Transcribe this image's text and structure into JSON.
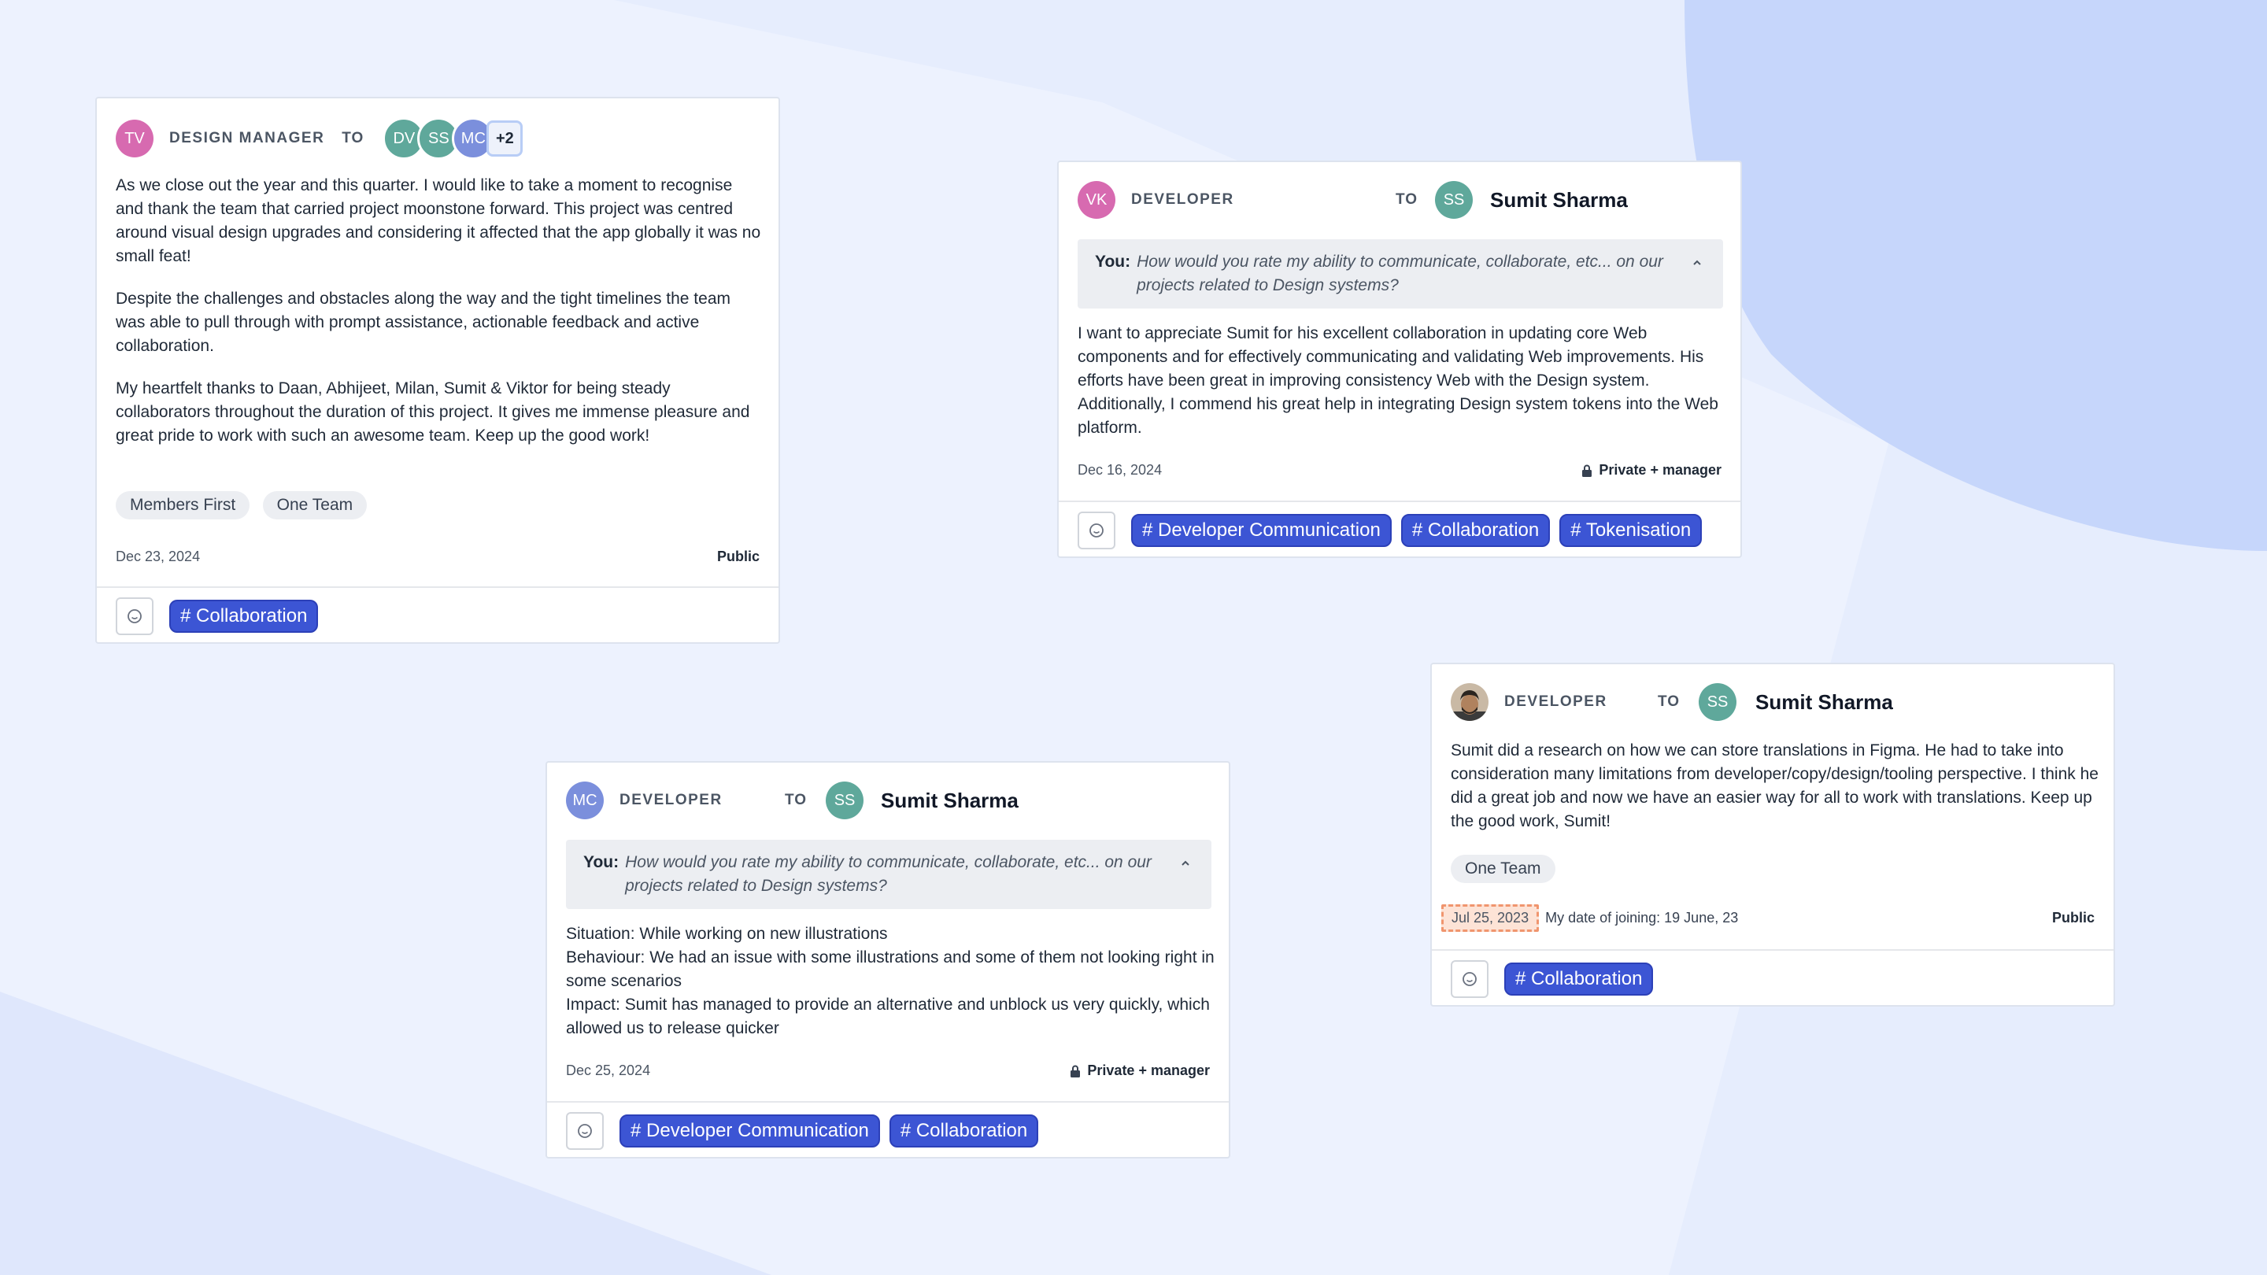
{
  "colors": {
    "background": "#e6edfd",
    "tag_blue": "#3c55d4",
    "avatar_pink": "#d76ab0",
    "avatar_teal": "#5fa89b",
    "avatar_periwinkle": "#7b8fdc"
  },
  "card1": {
    "author_initials": "TV",
    "author_role": "DESIGN MANAGER",
    "to_label": "TO",
    "recipients": [
      "DV",
      "SS",
      "MC"
    ],
    "more_count": "+2",
    "paragraphs": [
      "As we close out the year and this quarter. I would like to take a moment to recognise and thank the team that carried project moonstone forward. This project was centred around visual design upgrades and considering it affected that the app globally it was no small feat!",
      "Despite the challenges and obstacles along the way and the tight timelines the team was able to pull through with prompt assistance, actionable feedback and active collaboration.",
      "My heartfelt thanks to Daan, Abhijeet, Milan, Sumit & Viktor for being steady collaborators throughout the duration of this project. It gives me immense pleasure and great pride to work with such an awesome team. Keep up the good work!"
    ],
    "values": [
      "Members First",
      "One Team"
    ],
    "date": "Dec 23, 2024",
    "visibility": "Public",
    "tags": [
      "# Collaboration"
    ]
  },
  "card2": {
    "author_initials": "VK",
    "author_role": "DEVELOPER",
    "to_label": "TO",
    "recipient_initials": "SS",
    "recipient_name": "Sumit Sharma",
    "question_prefix": "You:",
    "question": "How would you rate my ability to communicate, collaborate, etc... on our projects related to Design systems?",
    "message": "I want to appreciate Sumit for his excellent collaboration in updating core Web components and for effectively communicating and validating Web improvements. His efforts have been great in improving consistency Web with the Design system. Additionally, I commend his great help in integrating Design system tokens into the Web platform.",
    "date": "Dec 16, 2024",
    "visibility": "Private + manager",
    "tags": [
      "# Developer Communication",
      "# Collaboration",
      "# Tokenisation"
    ]
  },
  "card3": {
    "author_initials": "MC",
    "author_role": "DEVELOPER",
    "to_label": "TO",
    "recipient_initials": "SS",
    "recipient_name": "Sumit Sharma",
    "question_prefix": "You:",
    "question": "How would you rate my ability to communicate, collaborate, etc... on our projects related to Design systems?",
    "lines": [
      "Situation: While working on new illustrations",
      "Behaviour: We had an issue with some illustrations and some of them not looking right in some scenarios",
      "Impact: Sumit has managed to provide an alternative and unblock us very quickly, which allowed us to release quicker"
    ],
    "date": "Dec 25, 2024",
    "visibility": "Private + manager",
    "tags": [
      "# Developer Communication",
      "# Collaboration"
    ]
  },
  "card4": {
    "author_role": "DEVELOPER",
    "to_label": "TO",
    "recipient_initials": "SS",
    "recipient_name": "Sumit Sharma",
    "message": "Sumit did a research on how we can store translations in Figma. He had to take into consideration many limitations from developer/copy/design/tooling perspective. I think he did a great job and now we have an easier way for all to work with translations. Keep up the good work, Sumit!",
    "values": [
      "One Team"
    ],
    "date": "Jul 25, 2023",
    "date_note": "My date of joining: 19 June, 23",
    "visibility": "Public",
    "tags": [
      "# Collaboration"
    ]
  }
}
